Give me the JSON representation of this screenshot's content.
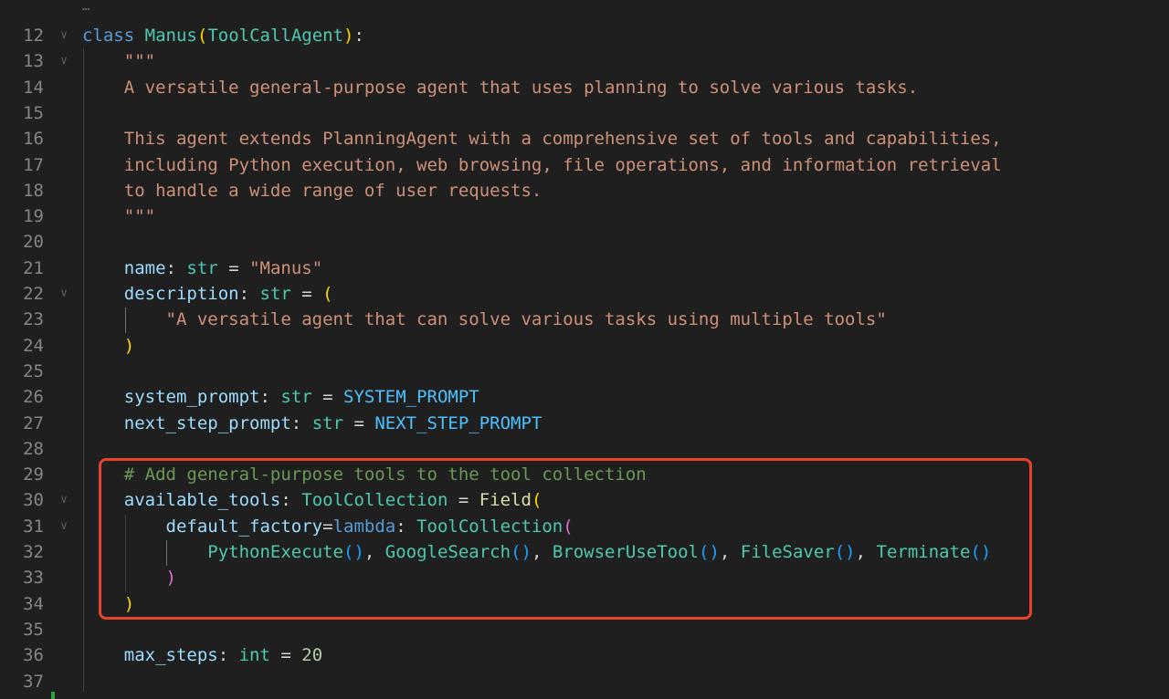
{
  "editor": {
    "fold_ellipsis": "…",
    "lines": [
      {
        "n": "12",
        "fold": true,
        "tokens": [
          [
            "kw",
            "class"
          ],
          [
            "op",
            " "
          ],
          [
            "cls",
            "Manus"
          ],
          [
            "p1",
            "("
          ],
          [
            "cls",
            "ToolCallAgent"
          ],
          [
            "p1",
            ")"
          ],
          [
            "op",
            ":"
          ]
        ]
      },
      {
        "n": "13",
        "fold": true,
        "tokens": [
          [
            "op",
            "    "
          ],
          [
            "str",
            "\"\"\""
          ]
        ]
      },
      {
        "n": "14",
        "fold": false,
        "tokens": [
          [
            "op",
            "    "
          ],
          [
            "str",
            "A versatile general-purpose agent that uses planning to solve various tasks."
          ]
        ]
      },
      {
        "n": "15",
        "fold": false,
        "tokens": []
      },
      {
        "n": "16",
        "fold": false,
        "tokens": [
          [
            "op",
            "    "
          ],
          [
            "str",
            "This agent extends PlanningAgent with a comprehensive set of tools and capabilities,"
          ]
        ]
      },
      {
        "n": "17",
        "fold": false,
        "tokens": [
          [
            "op",
            "    "
          ],
          [
            "str",
            "including Python execution, web browsing, file operations, and information retrieval"
          ]
        ]
      },
      {
        "n": "18",
        "fold": false,
        "tokens": [
          [
            "op",
            "    "
          ],
          [
            "str",
            "to handle a wide range of user requests."
          ]
        ]
      },
      {
        "n": "19",
        "fold": false,
        "tokens": [
          [
            "op",
            "    "
          ],
          [
            "str",
            "\"\"\""
          ]
        ]
      },
      {
        "n": "20",
        "fold": false,
        "tokens": []
      },
      {
        "n": "21",
        "fold": false,
        "tokens": [
          [
            "op",
            "    "
          ],
          [
            "var",
            "name"
          ],
          [
            "op",
            ": "
          ],
          [
            "cls",
            "str"
          ],
          [
            "op",
            " = "
          ],
          [
            "str",
            "\"Manus\""
          ]
        ]
      },
      {
        "n": "22",
        "fold": true,
        "tokens": [
          [
            "op",
            "    "
          ],
          [
            "var",
            "description"
          ],
          [
            "op",
            ": "
          ],
          [
            "cls",
            "str"
          ],
          [
            "op",
            " = "
          ],
          [
            "p1",
            "("
          ]
        ]
      },
      {
        "n": "23",
        "fold": false,
        "tokens": [
          [
            "op",
            "        "
          ],
          [
            "str",
            "\"A versatile agent that can solve various tasks using multiple tools\""
          ]
        ]
      },
      {
        "n": "24",
        "fold": false,
        "tokens": [
          [
            "op",
            "    "
          ],
          [
            "p1",
            ")"
          ]
        ]
      },
      {
        "n": "25",
        "fold": false,
        "tokens": []
      },
      {
        "n": "26",
        "fold": false,
        "tokens": [
          [
            "op",
            "    "
          ],
          [
            "var",
            "system_prompt"
          ],
          [
            "op",
            ": "
          ],
          [
            "cls",
            "str"
          ],
          [
            "op",
            " = "
          ],
          [
            "const",
            "SYSTEM_PROMPT"
          ]
        ]
      },
      {
        "n": "27",
        "fold": false,
        "tokens": [
          [
            "op",
            "    "
          ],
          [
            "var",
            "next_step_prompt"
          ],
          [
            "op",
            ": "
          ],
          [
            "cls",
            "str"
          ],
          [
            "op",
            " = "
          ],
          [
            "const",
            "NEXT_STEP_PROMPT"
          ]
        ]
      },
      {
        "n": "28",
        "fold": false,
        "tokens": []
      },
      {
        "n": "29",
        "fold": false,
        "tokens": [
          [
            "op",
            "    "
          ],
          [
            "cmt",
            "# Add general-purpose tools to the tool collection"
          ]
        ]
      },
      {
        "n": "30",
        "fold": true,
        "tokens": [
          [
            "op",
            "    "
          ],
          [
            "var",
            "available_tools"
          ],
          [
            "op",
            ": "
          ],
          [
            "cls",
            "ToolCollection"
          ],
          [
            "op",
            " = "
          ],
          [
            "fn",
            "Field"
          ],
          [
            "p1",
            "("
          ]
        ]
      },
      {
        "n": "31",
        "fold": true,
        "tokens": [
          [
            "op",
            "        "
          ],
          [
            "var",
            "default_factory"
          ],
          [
            "op",
            "="
          ],
          [
            "kw",
            "lambda"
          ],
          [
            "op",
            ": "
          ],
          [
            "cls",
            "ToolCollection"
          ],
          [
            "p2",
            "("
          ]
        ]
      },
      {
        "n": "32",
        "fold": false,
        "tokens": [
          [
            "op",
            "            "
          ],
          [
            "cls",
            "PythonExecute"
          ],
          [
            "p3",
            "()"
          ],
          [
            "op",
            ", "
          ],
          [
            "cls",
            "GoogleSearch"
          ],
          [
            "p3",
            "()"
          ],
          [
            "op",
            ", "
          ],
          [
            "cls",
            "BrowserUseTool"
          ],
          [
            "p3",
            "()"
          ],
          [
            "op",
            ", "
          ],
          [
            "cls",
            "FileSaver"
          ],
          [
            "p3",
            "()"
          ],
          [
            "op",
            ", "
          ],
          [
            "cls",
            "Terminate"
          ],
          [
            "p3",
            "()"
          ]
        ]
      },
      {
        "n": "33",
        "fold": false,
        "tokens": [
          [
            "op",
            "        "
          ],
          [
            "p2",
            ")"
          ]
        ]
      },
      {
        "n": "34",
        "fold": false,
        "tokens": [
          [
            "op",
            "    "
          ],
          [
            "p1",
            ")"
          ]
        ]
      },
      {
        "n": "35",
        "fold": false,
        "tokens": []
      },
      {
        "n": "36",
        "fold": false,
        "tokens": [
          [
            "op",
            "    "
          ],
          [
            "var",
            "max_steps"
          ],
          [
            "op",
            ": "
          ],
          [
            "cls",
            "int"
          ],
          [
            "op",
            " = "
          ],
          [
            "num",
            "20"
          ]
        ]
      },
      {
        "n": "37",
        "fold": false,
        "tokens": []
      }
    ]
  },
  "colors": {
    "background": "#1f1f1f",
    "highlight_border": "#e5432b",
    "keyword": "#569cd6",
    "class": "#4ec9b0",
    "string": "#ce9178",
    "variable": "#9cdcfe",
    "comment": "#6a9955"
  },
  "icons": {
    "fold": "chevron-down-icon"
  }
}
